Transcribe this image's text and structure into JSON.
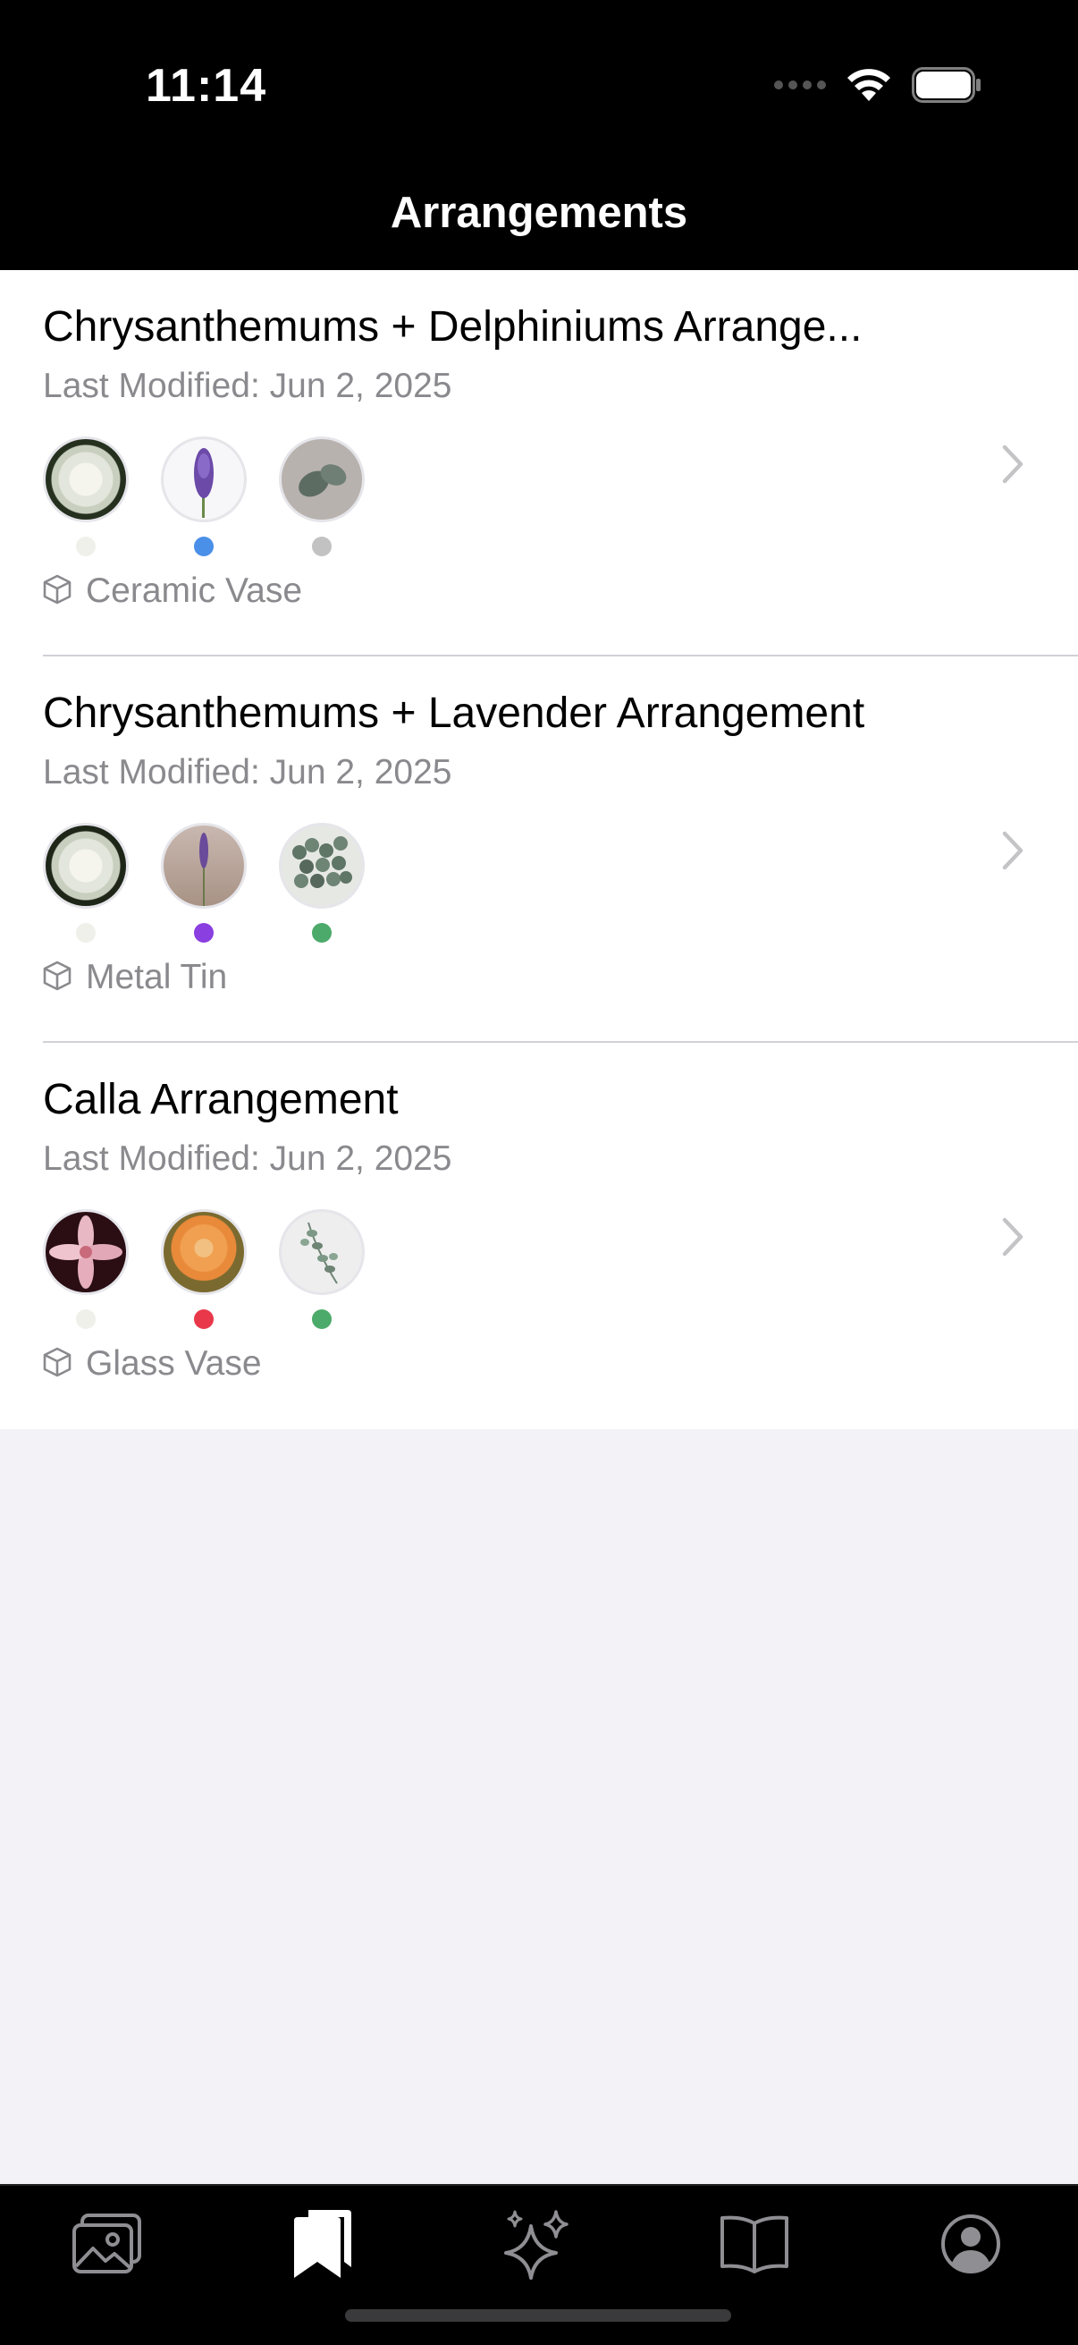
{
  "status": {
    "time": "11:14"
  },
  "nav": {
    "title": "Arrangements"
  },
  "arrangements": [
    {
      "title": "Chrysanthemums + Delphiniums Arrange...",
      "date": "Last Modified: Jun 2, 2025",
      "vessel": "Ceramic Vase",
      "flowers": [
        {
          "name": "white-chrysanthemum",
          "dot_color": "#f0f0ea"
        },
        {
          "name": "purple-delphinium",
          "dot_color": "#4a8fe8"
        },
        {
          "name": "eucalyptus-leaf",
          "dot_color": "#c2c2c2"
        }
      ]
    },
    {
      "title": "Chrysanthemums + Lavender Arrangement",
      "date": "Last Modified: Jun 2, 2025",
      "vessel": "Metal Tin",
      "flowers": [
        {
          "name": "white-chrysanthemum",
          "dot_color": "#f0f0ea"
        },
        {
          "name": "lavender-sprig",
          "dot_color": "#8a3fe0"
        },
        {
          "name": "eucalyptus-branch",
          "dot_color": "#4caa6a"
        }
      ]
    },
    {
      "title": "Calla Arrangement",
      "date": "Last Modified: Jun 2, 2025",
      "vessel": "Glass Vase",
      "flowers": [
        {
          "name": "pink-lily",
          "dot_color": "#f0f0ea"
        },
        {
          "name": "orange-dahlia",
          "dot_color": "#e8384a"
        },
        {
          "name": "eucalyptus-sprig",
          "dot_color": "#4caa6a"
        }
      ]
    }
  ],
  "tabs": [
    {
      "name": "tab-photos",
      "icon": "photo-icon",
      "active": false
    },
    {
      "name": "tab-arrangements",
      "icon": "bookmarks-icon",
      "active": true
    },
    {
      "name": "tab-ideas",
      "icon": "sparkles-icon",
      "active": false
    },
    {
      "name": "tab-guide",
      "icon": "book-icon",
      "active": false
    },
    {
      "name": "tab-profile",
      "icon": "person-circle-icon",
      "active": false
    }
  ]
}
